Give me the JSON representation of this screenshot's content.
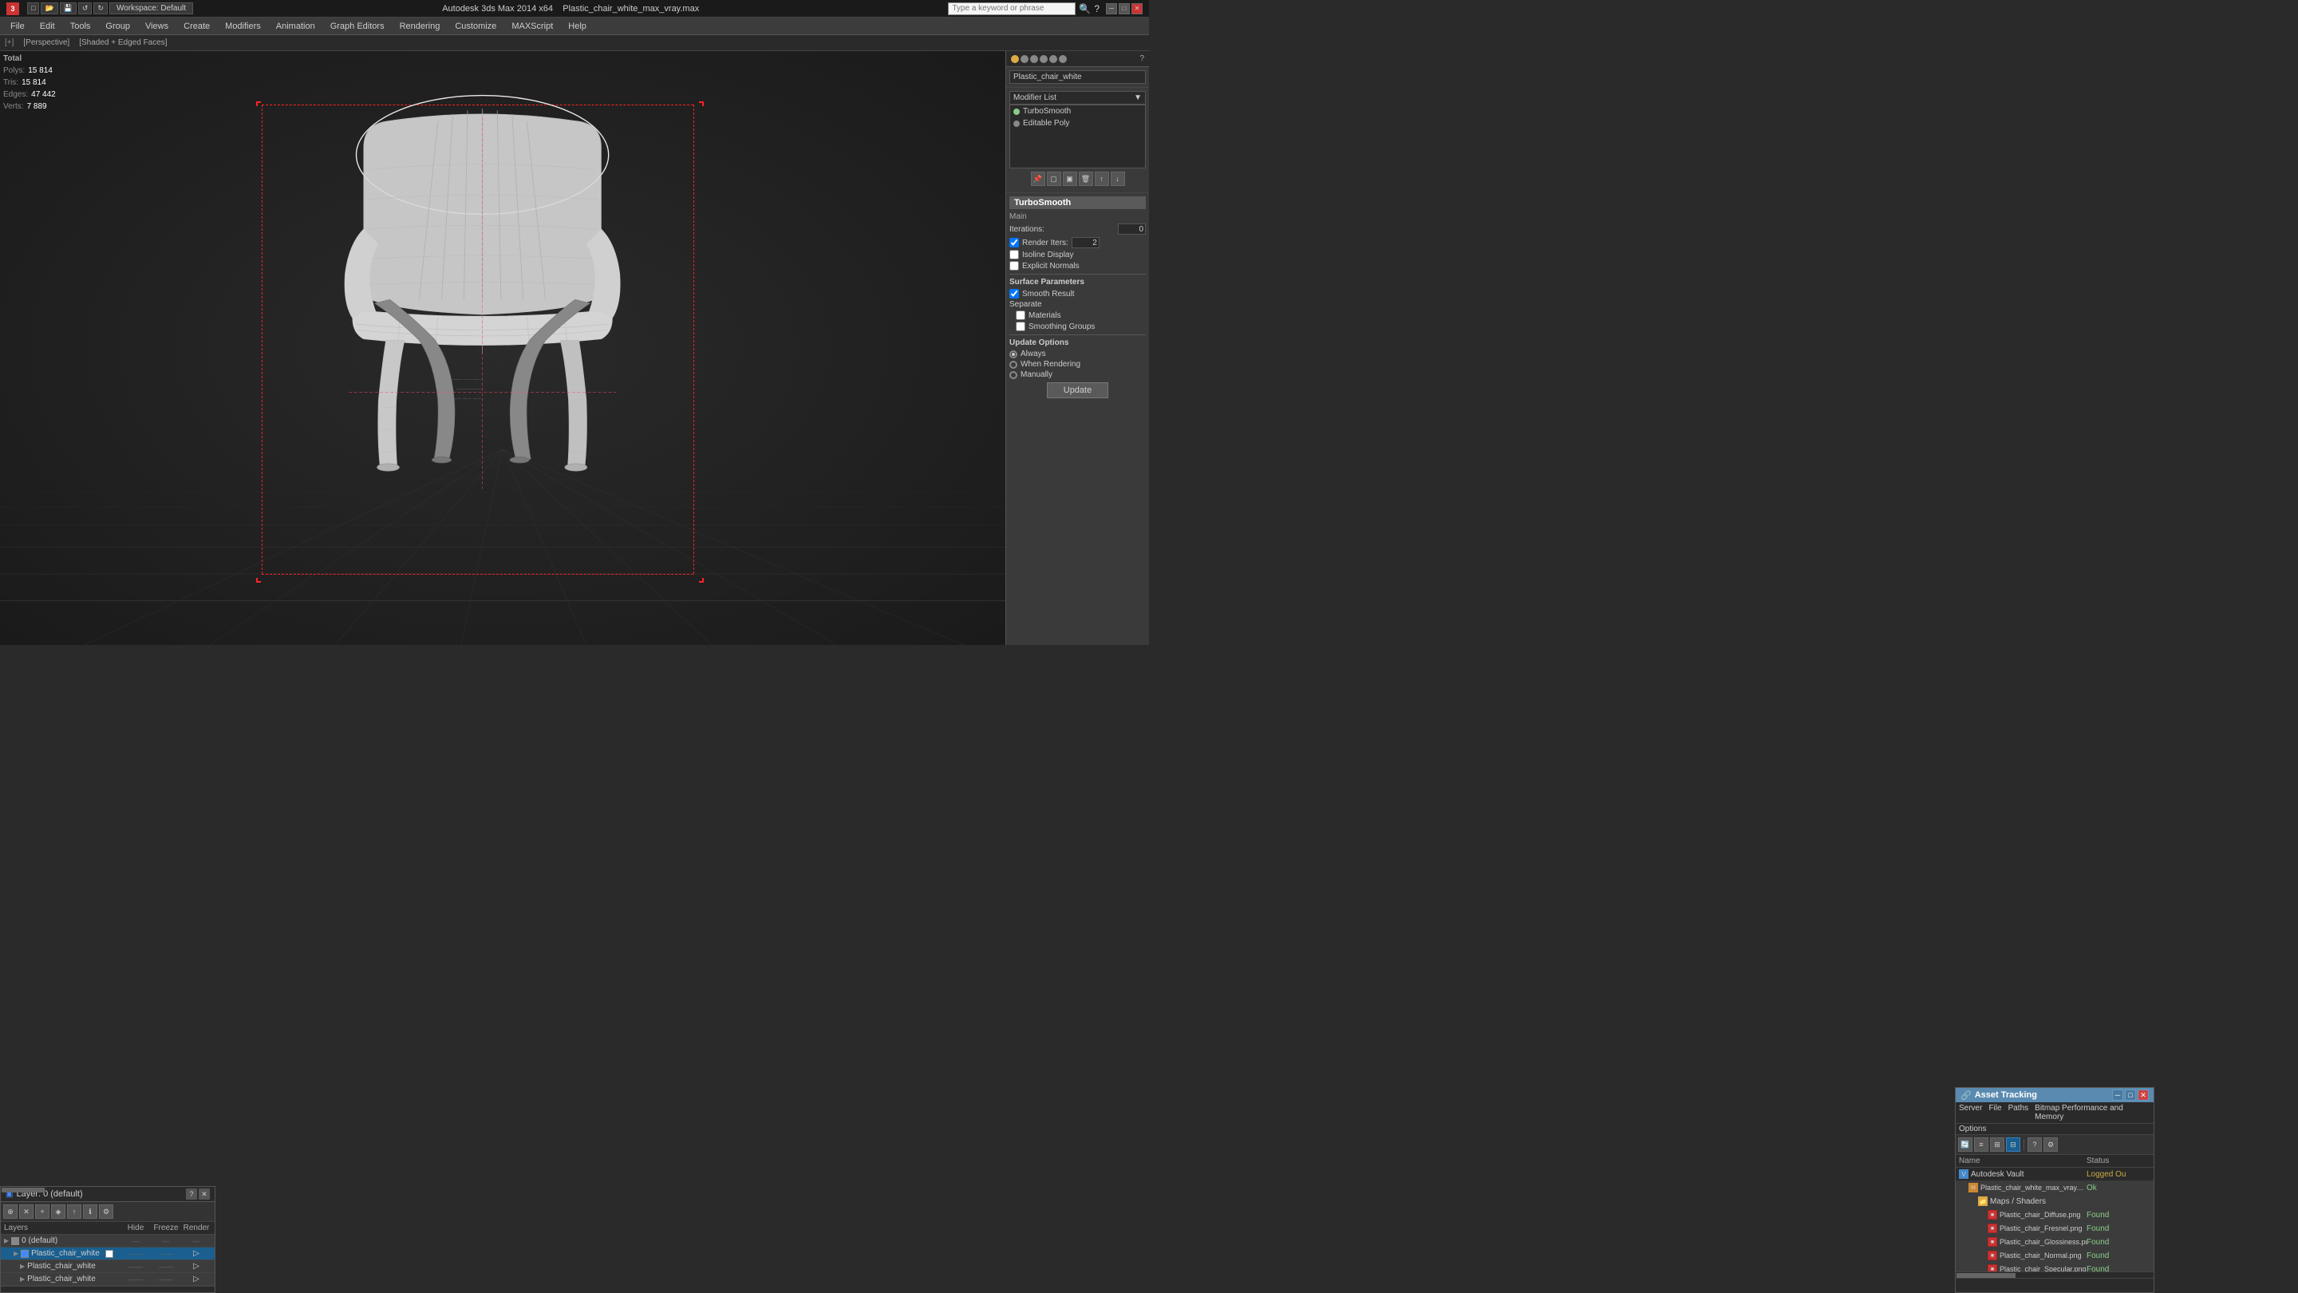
{
  "app": {
    "title": "Autodesk 3ds Max 2014 x64",
    "filename": "Plastic_chair_white_max_vray.max",
    "workspace": "Workspace: Default",
    "search_placeholder": "Type a keyword or phrase"
  },
  "menubar": {
    "items": [
      "File",
      "Edit",
      "Tools",
      "Group",
      "Views",
      "Create",
      "Modifiers",
      "Animation",
      "Graph Editors",
      "Rendering",
      "Customize",
      "MAXScript",
      "Help"
    ]
  },
  "viewport": {
    "label_bracket": "[+]",
    "label_perspective": "[Perspective]",
    "label_shading": "[Shaded + Edged Faces]"
  },
  "stats": {
    "total_label": "Total",
    "polys_label": "Polys:",
    "polys_value": "15 814",
    "tris_label": "Tris:",
    "tris_value": "15 814",
    "edges_label": "Edges:",
    "edges_value": "47 442",
    "verts_label": "Verts:",
    "verts_value": "7 889"
  },
  "right_panel": {
    "object_name": "Plastic_chair_white",
    "modifier_list_label": "Modifier List",
    "modifiers": [
      {
        "name": "TurboSmooth",
        "active": true
      },
      {
        "name": "Editable Poly",
        "active": false
      }
    ],
    "turbosmooth": {
      "label": "TurboSmooth",
      "main_label": "Main",
      "iterations_label": "Iterations:",
      "iterations_value": "0",
      "render_iters_label": "Render Iters:",
      "render_iters_value": "2",
      "render_iters_checked": true,
      "isoline_display_label": "Isoline Display",
      "explicit_normals_label": "Explicit Normals",
      "surface_params_label": "Surface Parameters",
      "smooth_result_label": "Smooth Result",
      "smooth_result_checked": true,
      "separate_label": "Separate",
      "materials_label": "Materials",
      "smoothing_groups_label": "Smoothing Groups",
      "update_options_label": "Update Options",
      "always_label": "Always",
      "when_rendering_label": "When Rendering",
      "manually_label": "Manually",
      "update_btn": "Update"
    }
  },
  "layer_panel": {
    "title": "Layer: 0 (default)",
    "layers_col": "Layers",
    "hide_col": "Hide",
    "freeze_col": "Freeze",
    "render_col": "Render",
    "rows": [
      {
        "name": "0 (default)",
        "level": 0,
        "selected": false,
        "color": "#888888"
      },
      {
        "name": "Plastic_chair_white",
        "level": 1,
        "selected": true,
        "color": "#4488ff"
      },
      {
        "name": "Plastic_chair_white",
        "level": 2,
        "selected": false,
        "color": "#888888"
      },
      {
        "name": "Plastic_chair_white",
        "level": 2,
        "selected": false,
        "color": "#888888"
      }
    ]
  },
  "asset_panel": {
    "title": "Asset Tracking",
    "menu": [
      "Server",
      "File",
      "Paths",
      "Bitmap Performance and Memory",
      "Options"
    ],
    "columns": {
      "name": "Name",
      "status": "Status"
    },
    "rows": [
      {
        "type": "vault",
        "name": "Autodesk Vault",
        "status": "Logged Ou",
        "indent": 0
      },
      {
        "type": "file",
        "name": "Plastic_chair_white_max_vray.max",
        "status": "Ok",
        "indent": 1
      },
      {
        "type": "folder",
        "name": "Maps / Shaders",
        "status": "",
        "indent": 2
      },
      {
        "type": "bitmap",
        "name": "Plastic_chair_Diffuse.png",
        "status": "Found",
        "indent": 3
      },
      {
        "type": "bitmap",
        "name": "Plastic_chair_Fresnel.png",
        "status": "Found",
        "indent": 3
      },
      {
        "type": "bitmap",
        "name": "Plastic_chair_Glossiness.png",
        "status": "Found",
        "indent": 3
      },
      {
        "type": "bitmap",
        "name": "Plastic_chair_Normal.png",
        "status": "Found",
        "indent": 3
      },
      {
        "type": "bitmap",
        "name": "Plastic_chair_Specular.png",
        "status": "Found",
        "indent": 3
      }
    ]
  },
  "icons": {
    "expand": "▶",
    "collapse": "▼",
    "arrow_right": "▸",
    "check": "✓",
    "close": "✕",
    "minimize": "─",
    "maximize": "□",
    "folder": "📁",
    "lightbulb": "●",
    "pin": "📌"
  }
}
